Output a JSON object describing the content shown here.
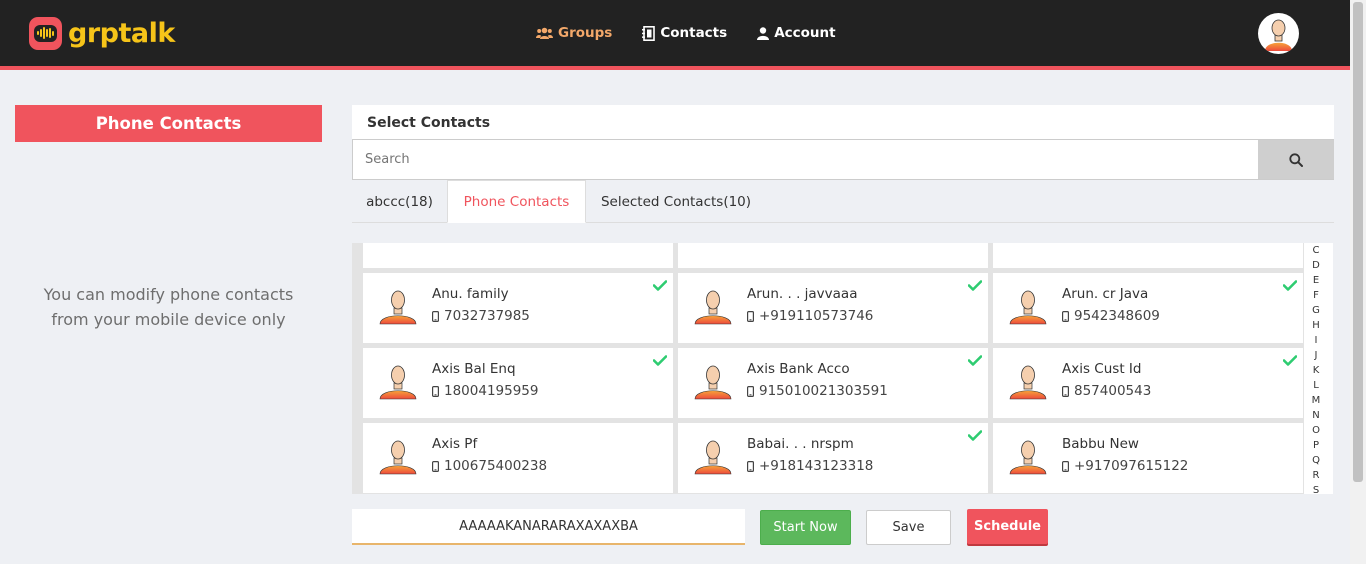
{
  "app": {
    "brand": "grptalk",
    "colors": {
      "accent": "#f0545d",
      "brand_yellow": "#f6c419",
      "header_bg": "#222222",
      "success": "#5cb85c",
      "nav_active": "#f3a86a"
    }
  },
  "nav": {
    "items": [
      {
        "label": "Groups",
        "icon": "users-icon",
        "active": true
      },
      {
        "label": "Contacts",
        "icon": "address-book-icon",
        "active": false
      },
      {
        "label": "Account",
        "icon": "user-icon",
        "active": false
      }
    ]
  },
  "left": {
    "title": "Phone Contacts",
    "note_line1": "You can modify phone contacts",
    "note_line2": "from your mobile device only"
  },
  "main": {
    "heading": "Select Contacts",
    "search_placeholder": "Search",
    "tabs": [
      {
        "label": "abccc(18)",
        "active": false
      },
      {
        "label": "Phone Contacts",
        "active": true
      },
      {
        "label": "Selected Contacts(10)",
        "active": false
      }
    ],
    "contacts": [
      {
        "name": "Anu. family",
        "phone": "7032737985",
        "selected": true
      },
      {
        "name": "Arun. . . javvaaa",
        "phone": "+919110573746",
        "selected": true
      },
      {
        "name": "Arun. cr Java",
        "phone": "9542348609",
        "selected": true
      },
      {
        "name": "Axis Bal Enq",
        "phone": "18004195959",
        "selected": true
      },
      {
        "name": "Axis Bank Acco",
        "phone": "915010021303591",
        "selected": true
      },
      {
        "name": "Axis Cust Id",
        "phone": "857400543",
        "selected": true
      },
      {
        "name": "Axis Pf",
        "phone": "100675400238",
        "selected": false
      },
      {
        "name": "Babai. . . nrspm",
        "phone": "+918143123318",
        "selected": true
      },
      {
        "name": "Babbu New",
        "phone": "+917097615122",
        "selected": false
      }
    ],
    "alphabet": [
      "C",
      "D",
      "E",
      "F",
      "G",
      "H",
      "I",
      "J",
      "K",
      "L",
      "M",
      "N",
      "O",
      "P",
      "Q",
      "R",
      "S"
    ]
  },
  "footer": {
    "conference_name": "AAAAAKANARARAXAXAXBA",
    "start_label": "Start Now",
    "save_label": "Save",
    "schedule_label": "Schedule"
  }
}
